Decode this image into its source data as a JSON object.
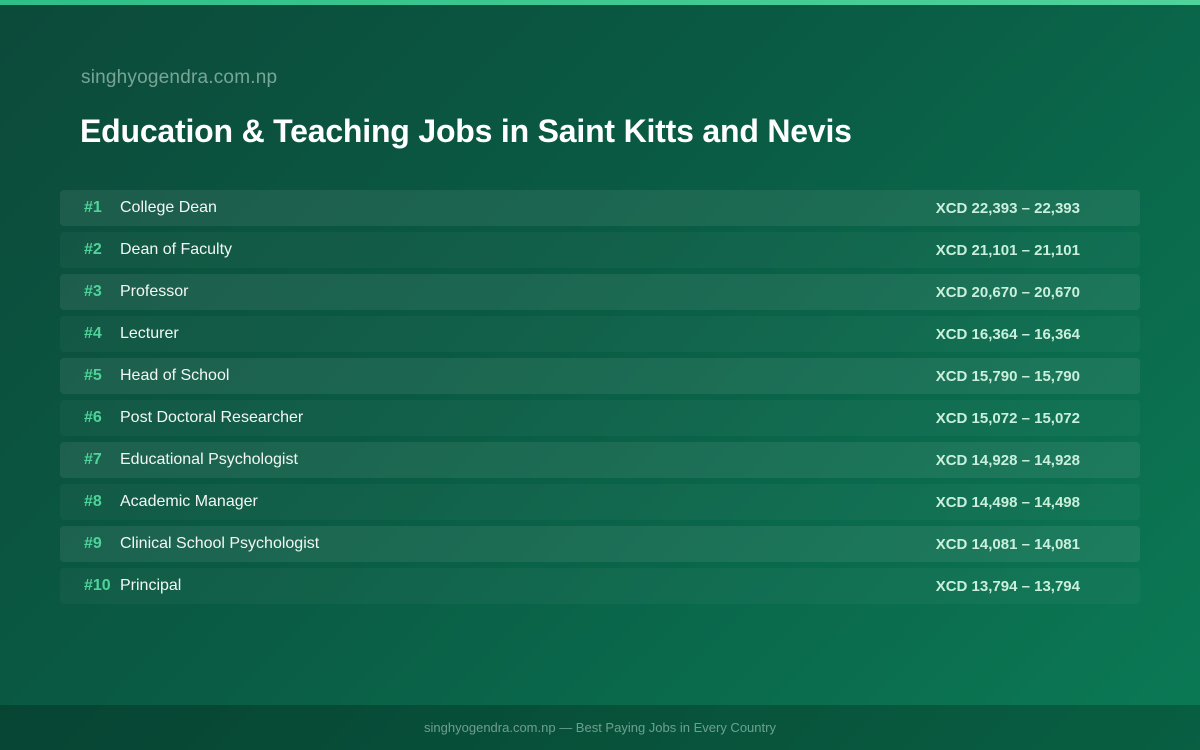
{
  "site": {
    "name": "singhyogendra.com.np"
  },
  "page": {
    "title": "Education & Teaching Jobs in Saint Kitts and Nevis"
  },
  "jobs": [
    {
      "rank": "#1",
      "title": "College Dean",
      "salary": "XCD 22,393 – 22,393"
    },
    {
      "rank": "#2",
      "title": "Dean of Faculty",
      "salary": "XCD 21,101 – 21,101"
    },
    {
      "rank": "#3",
      "title": "Professor",
      "salary": "XCD 20,670 – 20,670"
    },
    {
      "rank": "#4",
      "title": "Lecturer",
      "salary": "XCD 16,364 – 16,364"
    },
    {
      "rank": "#5",
      "title": "Head of School",
      "salary": "XCD 15,790 – 15,790"
    },
    {
      "rank": "#6",
      "title": "Post Doctoral Researcher",
      "salary": "XCD 15,072 – 15,072"
    },
    {
      "rank": "#7",
      "title": "Educational Psychologist",
      "salary": "XCD 14,928 – 14,928"
    },
    {
      "rank": "#8",
      "title": "Academic Manager",
      "salary": "XCD 14,498 – 14,498"
    },
    {
      "rank": "#9",
      "title": "Clinical School Psychologist",
      "salary": "XCD 14,081 – 14,081"
    },
    {
      "rank": "#10",
      "title": "Principal",
      "salary": "XCD 13,794 – 13,794"
    }
  ],
  "footer": {
    "text": "singhyogendra.com.np — Best Paying Jobs in Every Country"
  },
  "colors": {
    "accent": "#4fd39b",
    "background_start": "#0c4a3a",
    "background_end": "#0b7a55"
  }
}
